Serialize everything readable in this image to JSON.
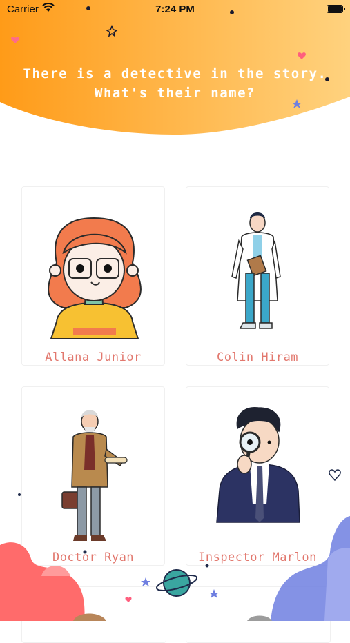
{
  "status_bar": {
    "carrier": "Carrier",
    "time": "7:24 PM"
  },
  "quiz": {
    "question": "There is a detective in the story.\nWhat's their name?",
    "options": [
      {
        "label": "Allana Junior",
        "portrait": "girl-with-glasses"
      },
      {
        "label": "Colin Hiram",
        "portrait": "man-in-lab-coat"
      },
      {
        "label": "Doctor Ryan",
        "portrait": "old-professor"
      },
      {
        "label": "Inspector Marlon",
        "portrait": "detective-with-magnifier"
      }
    ]
  },
  "colors": {
    "header_start": "#ff9f1c",
    "header_end": "#ffd37a",
    "option_text": "#e2786e",
    "accent_blue": "#6f7fe0",
    "accent_red": "#ff6f6f"
  }
}
